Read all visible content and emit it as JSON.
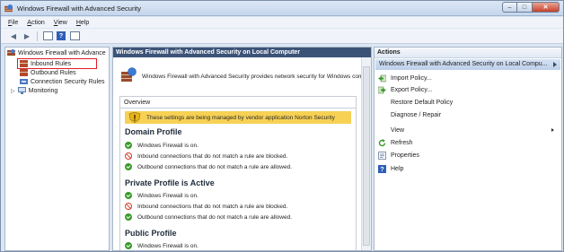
{
  "window": {
    "title": "Windows Firewall with Advanced Security"
  },
  "menubar": {
    "items": [
      {
        "first": "F",
        "rest": "ile"
      },
      {
        "first": "A",
        "rest": "ction"
      },
      {
        "first": "V",
        "rest": "iew"
      },
      {
        "first": "H",
        "rest": "elp"
      }
    ]
  },
  "tree": {
    "root": "Windows Firewall with Advance",
    "inbound": "Inbound Rules",
    "outbound": "Outbound Rules",
    "connection": "Connection Security Rules",
    "monitoring": "Monitoring"
  },
  "center": {
    "header": "Windows Firewall with Advanced Security on Local Computer",
    "intro": "Windows Firewall with Advanced Security provides network security for Windows compu",
    "overview_label": "Overview",
    "warning": "These settings are being managed by vendor application Norton Security",
    "domain": {
      "title": "Domain Profile",
      "s1": "Windows Firewall is on.",
      "s2": "Inbound connections that do not match a rule are blocked.",
      "s3": "Outbound connections that do not match a rule are allowed."
    },
    "private": {
      "title": "Private Profile is Active",
      "s1": "Windows Firewall is on.",
      "s2": "Inbound connections that do not match a rule are blocked.",
      "s3": "Outbound connections that do not match a rule are allowed."
    },
    "public": {
      "title": "Public Profile",
      "s1": "Windows Firewall is on."
    }
  },
  "actions": {
    "header": "Actions",
    "subheader": "Windows Firewall with Advanced Security on Local Compu...",
    "import": "Import Policy...",
    "export": "Export Policy...",
    "restore": "Restore Default Policy",
    "diagnose": "Diagnose / Repair",
    "view": "View",
    "refresh": "Refresh",
    "properties": "Properties",
    "help": "Help"
  },
  "colors": {
    "header_bg": "#3c5378",
    "warning_bg": "#f7d154",
    "highlight_border": "#e01b24"
  },
  "icons": [
    "firewall-icon",
    "back-icon",
    "forward-icon",
    "console-tree-icon",
    "help-icon",
    "properties-icon",
    "warning-icon",
    "check-icon",
    "block-icon",
    "import-icon",
    "export-icon",
    "refresh-icon"
  ]
}
